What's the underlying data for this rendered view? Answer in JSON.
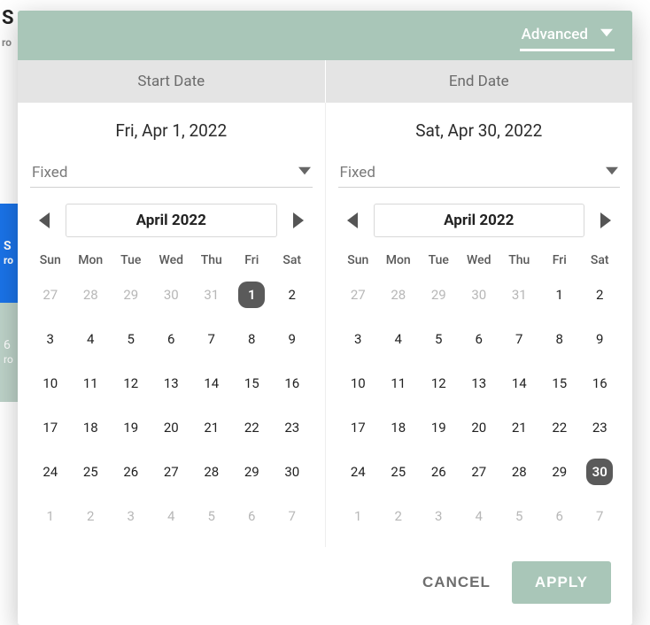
{
  "topbar": {
    "advanced_label": "Advanced"
  },
  "tabs": {
    "start": "Start Date",
    "end": "End Date"
  },
  "start": {
    "selected_label": "Fri, Apr 1, 2022",
    "mode": "Fixed",
    "month_label": "April 2022",
    "selected_day": 1,
    "dow": [
      "Sun",
      "Mon",
      "Tue",
      "Wed",
      "Thu",
      "Fri",
      "Sat"
    ],
    "weeks": [
      [
        {
          "n": 27,
          "o": true
        },
        {
          "n": 28,
          "o": true
        },
        {
          "n": 29,
          "o": true
        },
        {
          "n": 30,
          "o": true
        },
        {
          "n": 31,
          "o": true
        },
        {
          "n": 1
        },
        {
          "n": 2
        }
      ],
      [
        {
          "n": 3
        },
        {
          "n": 4
        },
        {
          "n": 5
        },
        {
          "n": 6
        },
        {
          "n": 7
        },
        {
          "n": 8
        },
        {
          "n": 9
        }
      ],
      [
        {
          "n": 10
        },
        {
          "n": 11
        },
        {
          "n": 12
        },
        {
          "n": 13
        },
        {
          "n": 14
        },
        {
          "n": 15
        },
        {
          "n": 16
        }
      ],
      [
        {
          "n": 17
        },
        {
          "n": 18
        },
        {
          "n": 19
        },
        {
          "n": 20
        },
        {
          "n": 21
        },
        {
          "n": 22
        },
        {
          "n": 23
        }
      ],
      [
        {
          "n": 24
        },
        {
          "n": 25
        },
        {
          "n": 26
        },
        {
          "n": 27
        },
        {
          "n": 28
        },
        {
          "n": 29
        },
        {
          "n": 30
        }
      ],
      [
        {
          "n": 1,
          "o": true
        },
        {
          "n": 2,
          "o": true
        },
        {
          "n": 3,
          "o": true
        },
        {
          "n": 4,
          "o": true
        },
        {
          "n": 5,
          "o": true
        },
        {
          "n": 6,
          "o": true
        },
        {
          "n": 7,
          "o": true
        }
      ]
    ]
  },
  "end": {
    "selected_label": "Sat, Apr 30, 2022",
    "mode": "Fixed",
    "month_label": "April 2022",
    "selected_day": 30,
    "dow": [
      "Sun",
      "Mon",
      "Tue",
      "Wed",
      "Thu",
      "Fri",
      "Sat"
    ],
    "weeks": [
      [
        {
          "n": 27,
          "o": true
        },
        {
          "n": 28,
          "o": true
        },
        {
          "n": 29,
          "o": true
        },
        {
          "n": 30,
          "o": true
        },
        {
          "n": 31,
          "o": true
        },
        {
          "n": 1
        },
        {
          "n": 2
        }
      ],
      [
        {
          "n": 3
        },
        {
          "n": 4
        },
        {
          "n": 5
        },
        {
          "n": 6
        },
        {
          "n": 7
        },
        {
          "n": 8
        },
        {
          "n": 9
        }
      ],
      [
        {
          "n": 10
        },
        {
          "n": 11
        },
        {
          "n": 12
        },
        {
          "n": 13
        },
        {
          "n": 14
        },
        {
          "n": 15
        },
        {
          "n": 16
        }
      ],
      [
        {
          "n": 17
        },
        {
          "n": 18
        },
        {
          "n": 19
        },
        {
          "n": 20
        },
        {
          "n": 21
        },
        {
          "n": 22
        },
        {
          "n": 23
        }
      ],
      [
        {
          "n": 24
        },
        {
          "n": 25
        },
        {
          "n": 26
        },
        {
          "n": 27
        },
        {
          "n": 28
        },
        {
          "n": 29
        },
        {
          "n": 30
        }
      ],
      [
        {
          "n": 1,
          "o": true
        },
        {
          "n": 2,
          "o": true
        },
        {
          "n": 3,
          "o": true
        },
        {
          "n": 4,
          "o": true
        },
        {
          "n": 5,
          "o": true
        },
        {
          "n": 6,
          "o": true
        },
        {
          "n": 7,
          "o": true
        }
      ]
    ]
  },
  "actions": {
    "cancel": "CANCEL",
    "apply": "APPLY"
  }
}
